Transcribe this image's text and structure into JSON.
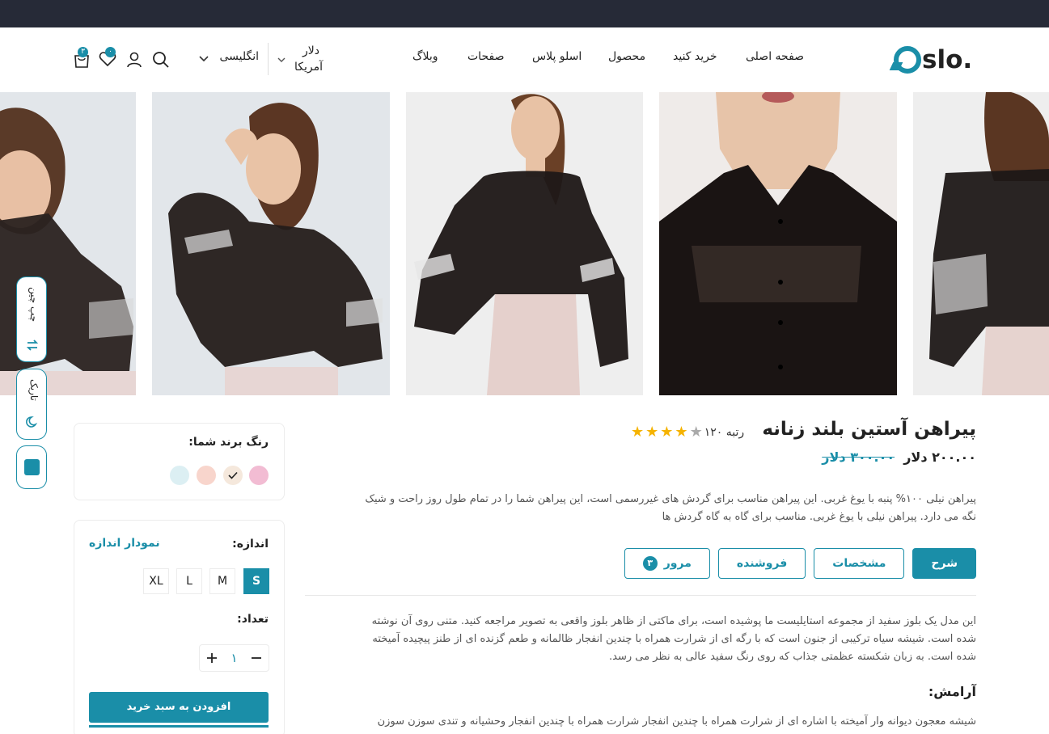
{
  "header": {
    "logo_text": "slo.",
    "nav": [
      "صفحه اصلی",
      "خرید کنید",
      "محصول",
      "اسلو پلاس",
      "صفحات",
      "وبلاگ"
    ],
    "currency_line1": "دلار",
    "currency_line2": "آمریکا",
    "language": "انگلیسی",
    "cart_count": "۳",
    "wishlist_count": "۰",
    "icons": [
      "cart-icon",
      "heart-icon",
      "user-icon",
      "search-icon",
      "chevron-down-icon"
    ]
  },
  "gallery": {
    "images": [
      "model-smiling-side",
      "model-hand-in-hair",
      "model-front-full",
      "blouse-collar-closeup",
      "blouse-back-view"
    ]
  },
  "product": {
    "title": "پیراهن آستین بلند زنانه",
    "rating_stars": 4,
    "rating_max": 5,
    "rank_label": "رتبه ۱۲۰",
    "price_current": "۲۰۰.۰۰ دلار",
    "price_old": "۳۰۰.۰۰ دلار",
    "description_line1": "پیراهن نیلی ۱۰۰% پنبه با یوغ غربی. این پیراهن مناسب برای گردش های غیررسمی است، این پیراهن شما را در تمام طول روز راحت و شیک",
    "description_line2": "نگه می دارد. پیراهن نیلی با یوغ غربی. مناسب برای گاه به گاه گردش ها"
  },
  "tabs": [
    {
      "label": "شرح"
    },
    {
      "label": "مشخصات"
    },
    {
      "label": "فروشنده"
    },
    {
      "label": "مرور",
      "count": "۳"
    }
  ],
  "details": {
    "paragraph_line1": "این مدل یک بلوز سفید از مجموعه استایلیست ما پوشیده است، برای ماکتی از ظاهر بلوز واقعی به تصویر مراجعه کنید. متنی روی آن نوشته",
    "paragraph_line2": "شده است. شیشه سیاه ترکیبی از جنون است که با رگه ای از شرارت همراه با چندین انفجار ظالمانه و طعم گزنده ای از طنز پیچیده آمیخته",
    "paragraph_line3": "شده است. به زبان شکسته عظمتی جذاب که روی رنگ سفید عالی به نظر می رسد.",
    "subheading": "آرامش:",
    "paragraph2_line1": "شیشه معجون دیوانه وار آمیخته با اشاره ای از شرارت همراه با چندین انفجار شرارت همراه با چندین انفجار وحشیانه و تندی سوزن سوزن"
  },
  "color_card": {
    "label": "رنگ برند شما:",
    "swatches": [
      "#f2bcd3",
      "#f5e8dc",
      "#f8d5cc",
      "#dceff3"
    ],
    "selected_index": 1
  },
  "size_card": {
    "label": "اندازه:",
    "chart_link": "نمودار اندازه",
    "sizes": [
      "S",
      "M",
      "L",
      "XL"
    ],
    "selected": "S",
    "qty_label": "تعداد:",
    "qty_value": "۱",
    "add_to_cart": "افزودن به سبد خرید"
  },
  "floating": {
    "rtl_label": "چپ چین",
    "dark_label": "تاریک"
  },
  "colors": {
    "accent": "#1a8ea8",
    "topbar": "#262a37",
    "star": "#f5b301",
    "star_empty": "#aaaaaa"
  }
}
